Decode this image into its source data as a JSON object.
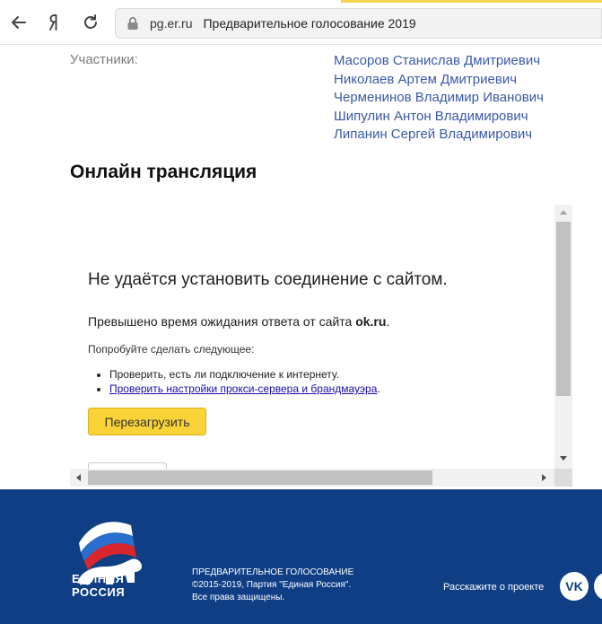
{
  "browser": {
    "domain": "pg.er.ru",
    "page_title": "Предварительное голосование 2019",
    "icons": [
      "back-arrow-icon",
      "yandex-logo-icon",
      "reload-icon",
      "lock-icon"
    ]
  },
  "participants": {
    "label": "Участники:",
    "names": [
      "Масоров Станислав Дмитриевич",
      "Николаев Артем Дмитриевич",
      "Черменинов Владимир Иванович",
      "Шипулин Антон Владимирович",
      "Липанин Сергей Владимирович"
    ]
  },
  "broadcast": {
    "title": "Онлайн трансляция"
  },
  "error": {
    "title": "Не удаётся установить соединение с сайтом.",
    "message_prefix": "Превышено время ожидания ответа от сайта ",
    "message_site": "ok.ru",
    "message_suffix": ".",
    "try_label": "Попробуйте сделать следующее:",
    "suggestion_1": "Проверить, есть ли подключение к интернету.",
    "suggestion_2_link": "Проверить настройки прокси-сервера и брандмауэра",
    "suggestion_2_suffix": ".",
    "reload_label": "Перезагрузить"
  },
  "footer": {
    "logo_line1": "ЕДИНАЯ",
    "logo_line2": "РОССИЯ",
    "line1": "ПРЕДВАРИТЕЛЬНОЕ ГОЛОСОВАНИЕ",
    "line2": "©2015-2019, Партия \"Единая Россия\".",
    "line3": "Все права защищены.",
    "tell_label": "Расскажите о проекте",
    "vk_label": "VK",
    "bg_color": "#0f3e85"
  },
  "colors": {
    "link": "#3a5aa8",
    "reload_button": "#f9d338",
    "tab_accent": "#f3d64f"
  }
}
